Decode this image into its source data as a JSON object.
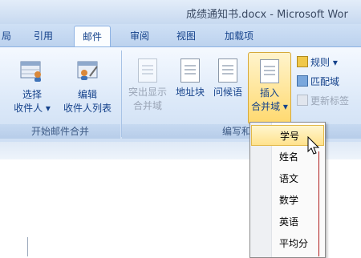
{
  "window": {
    "title": "成绩通知书.docx - Microsoft Wor"
  },
  "tabs": [
    "局",
    "引用",
    "邮件",
    "审阅",
    "视图",
    "加载项"
  ],
  "ribbon": {
    "start_merge_group": {
      "label": "开始邮件合并",
      "select_recipients": [
        "选择",
        "收件人"
      ],
      "edit_recipients": [
        "编辑",
        "收件人列表"
      ]
    },
    "write_insert_group": {
      "label": "编写和插",
      "highlight_fields": [
        "突出显示",
        "合并域"
      ],
      "address_block": "地址块",
      "greeting_line": "问候语",
      "insert_merge_field": [
        "插入",
        "合并域"
      ],
      "rules": "规则",
      "match_fields": "匹配域",
      "update_labels": "更新标签"
    }
  },
  "dropdown": {
    "items": [
      "学号",
      "姓名",
      "语文",
      "数学",
      "英语",
      "平均分"
    ],
    "hover_index": 0
  }
}
